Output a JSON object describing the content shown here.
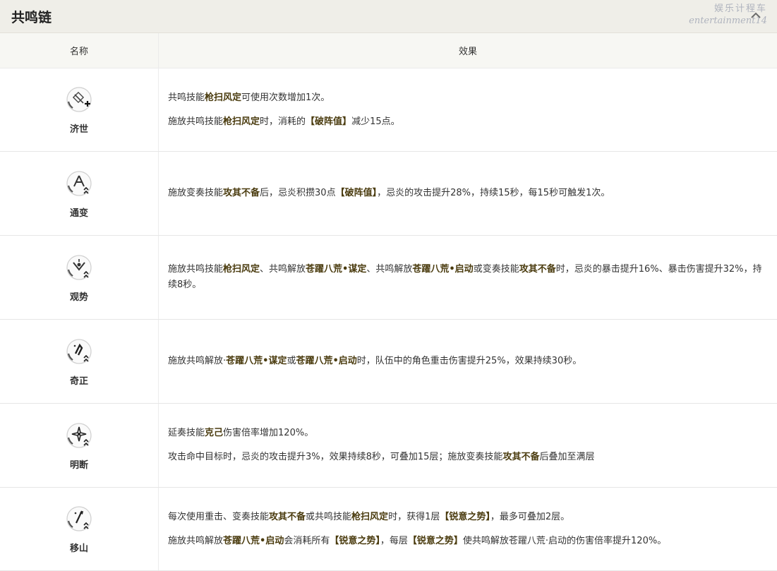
{
  "header": {
    "title": "共鸣链",
    "watermark_line1": "娱乐计程车",
    "watermark_line2": "entertainment14"
  },
  "table": {
    "columns": [
      "名称",
      "效果"
    ],
    "rows": [
      {
        "name": "济世",
        "icon": "heal-plus-icon",
        "paragraphs": [
          [
            {
              "t": "共鸣技能"
            },
            {
              "t": "枪扫风定",
              "k": true
            },
            {
              "t": "可使用次数增加1次。"
            }
          ],
          [
            {
              "t": "施放共鸣技能"
            },
            {
              "t": "枪扫风定",
              "k": true
            },
            {
              "t": "时，消耗的"
            },
            {
              "t": "【破阵值】",
              "k": true
            },
            {
              "t": "减少15点。"
            }
          ]
        ]
      },
      {
        "name": "通变",
        "icon": "triangle-rank-icon",
        "paragraphs": [
          [
            {
              "t": "施放变奏技能"
            },
            {
              "t": "攻其不备",
              "k": true
            },
            {
              "t": "后，忌炎积攒30点"
            },
            {
              "t": "【破阵值】",
              "k": true
            },
            {
              "t": "，忌炎的攻击提升28%，持续15秒，每15秒可触发1次。"
            }
          ]
        ]
      },
      {
        "name": "观势",
        "icon": "eye-rank-icon",
        "paragraphs": [
          [
            {
              "t": "施放共鸣技能"
            },
            {
              "t": "枪扫风定",
              "k": true
            },
            {
              "t": "、共鸣解放"
            },
            {
              "t": "苍躍八荒•谋定",
              "k": true
            },
            {
              "t": "、共鸣解放"
            },
            {
              "t": "苍躍八荒•启动",
              "k": true
            },
            {
              "t": "或变奏技能"
            },
            {
              "t": "攻其不备",
              "k": true
            },
            {
              "t": "时，忌炎的暴击提升16%、暴击伤害提升32%，持续8秒。"
            }
          ]
        ]
      },
      {
        "name": "奇正",
        "icon": "figure-rank-icon",
        "paragraphs": [
          [
            {
              "t": "施放共鸣解放·"
            },
            {
              "t": "苍躍八荒•谋定",
              "k": true
            },
            {
              "t": "或"
            },
            {
              "t": "苍躍八荒•启动",
              "k": true
            },
            {
              "t": "时，队伍中的角色重击伤害提升25%，效果持续30秒。"
            }
          ]
        ]
      },
      {
        "name": "明断",
        "icon": "star-rank-icon",
        "paragraphs": [
          [
            {
              "t": "延奏技能"
            },
            {
              "t": "克己",
              "k": true
            },
            {
              "t": "伤害倍率增加120%。"
            }
          ],
          [
            {
              "t": "攻击命中目标时，忌炎的攻击提升3%，效果持续8秒，可叠加15层；施放变奏技能"
            },
            {
              "t": "攻其不备",
              "k": true
            },
            {
              "t": "后叠加至满层"
            }
          ]
        ]
      },
      {
        "name": "移山",
        "icon": "spear-rank-icon",
        "paragraphs": [
          [
            {
              "t": "每次使用重击、变奏技能"
            },
            {
              "t": "攻其不备",
              "k": true
            },
            {
              "t": "或共鸣技能"
            },
            {
              "t": "枪扫风定",
              "k": true
            },
            {
              "t": "时，获得1层"
            },
            {
              "t": "【锐意之势】",
              "k": true
            },
            {
              "t": "，最多可叠加2层。"
            }
          ],
          [
            {
              "t": "施放共鸣解放"
            },
            {
              "t": "苍躍八荒•启动",
              "k": true
            },
            {
              "t": "会消耗所有"
            },
            {
              "t": "【锐意之势】",
              "k": true
            },
            {
              "t": "，每层"
            },
            {
              "t": "【锐意之势】",
              "k": true
            },
            {
              "t": "使共鸣解放苍躍八荒·启动的伤害倍率提升120%。"
            }
          ]
        ]
      }
    ]
  }
}
